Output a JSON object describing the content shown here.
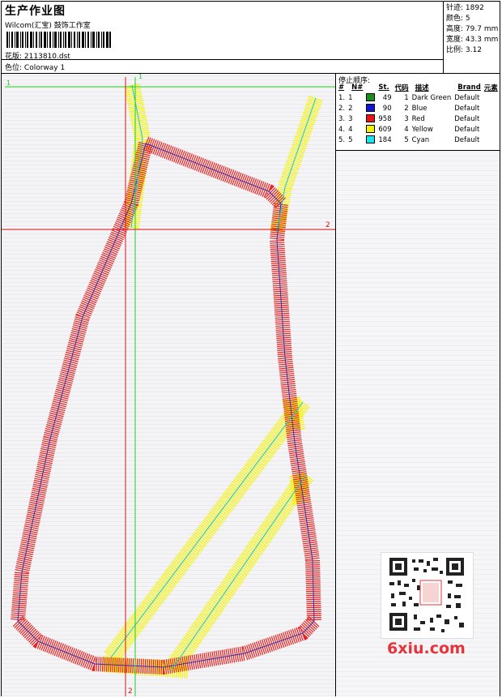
{
  "header": {
    "title": "生产作业图",
    "studio": "Wilcom(汇宝) 鼓饰工作室",
    "design_label": "花版:",
    "design_value": "2113810.dst",
    "colorway_label": "色位:",
    "colorway_value": "Colorway 1"
  },
  "stats": [
    {
      "label": "针迹:",
      "value": "1892"
    },
    {
      "label": "颜色:",
      "value": "5"
    },
    {
      "label": "高度:",
      "value": "79.7 mm"
    },
    {
      "label": "宽度:",
      "value": "43.3 mm"
    },
    {
      "label": "比例:",
      "value": "3.12"
    }
  ],
  "stop_sequence": {
    "title": "停止顺序:",
    "columns": [
      "#",
      "N#",
      "St.",
      "代码",
      "描述",
      "Brand",
      "元素"
    ],
    "rows": [
      {
        "idx": "1.",
        "n": "1",
        "color": "#1e8c1e",
        "stitches": "49",
        "code": "1",
        "desc": "Dark Green",
        "brand": "Default"
      },
      {
        "idx": "2.",
        "n": "2",
        "color": "#1414d8",
        "stitches": "90",
        "code": "2",
        "desc": "Blue",
        "brand": "Default"
      },
      {
        "idx": "3.",
        "n": "3",
        "color": "#e81414",
        "stitches": "958",
        "code": "3",
        "desc": "Red",
        "brand": "Default"
      },
      {
        "idx": "4.",
        "n": "4",
        "color": "#f2f200",
        "stitches": "609",
        "code": "4",
        "desc": "Yellow",
        "brand": "Default"
      },
      {
        "idx": "5.",
        "n": "5",
        "color": "#14e8e8",
        "stitches": "184",
        "code": "5",
        "desc": "Cyan",
        "brand": "Default"
      }
    ]
  },
  "guides": {
    "vertical_1": "1",
    "horizontal_1": "1",
    "horizontal_2": "2",
    "vertical_2": "2"
  },
  "watermark": {
    "site": "6xiu.com"
  },
  "colors": {
    "red_stitch": "#e81414",
    "yellow_stitch": "#f2f200",
    "guide_green": "#22cc22",
    "guide_red": "#dd1111",
    "cyan_path": "#14c8d8",
    "blue_path": "#3333aa"
  }
}
